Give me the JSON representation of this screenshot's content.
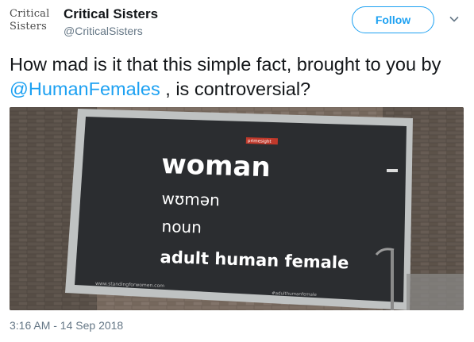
{
  "account": {
    "display_name": "Critical Sisters",
    "handle": "@CriticalSisters",
    "avatar_text_line1": "Critical",
    "avatar_text_line2": "Sisters"
  },
  "follow_button": {
    "label": "Follow"
  },
  "tweet": {
    "text_before": "How mad is it that this simple fact, brought to you by ",
    "mention": "@HumanFemales",
    "text_after": " , is controversial?",
    "timestamp": "3:16 AM - 14 Sep 2018"
  },
  "billboard": {
    "word": "woman",
    "phonetic": "wʊmən",
    "part_of_speech": "noun",
    "definition": "adult human female",
    "tag_label": "primesight"
  },
  "icons": {
    "more": "chevron-down-icon"
  },
  "colors": {
    "accent": "#1da1f2",
    "secondary_text": "#657786",
    "billboard": "#2b2d30"
  }
}
